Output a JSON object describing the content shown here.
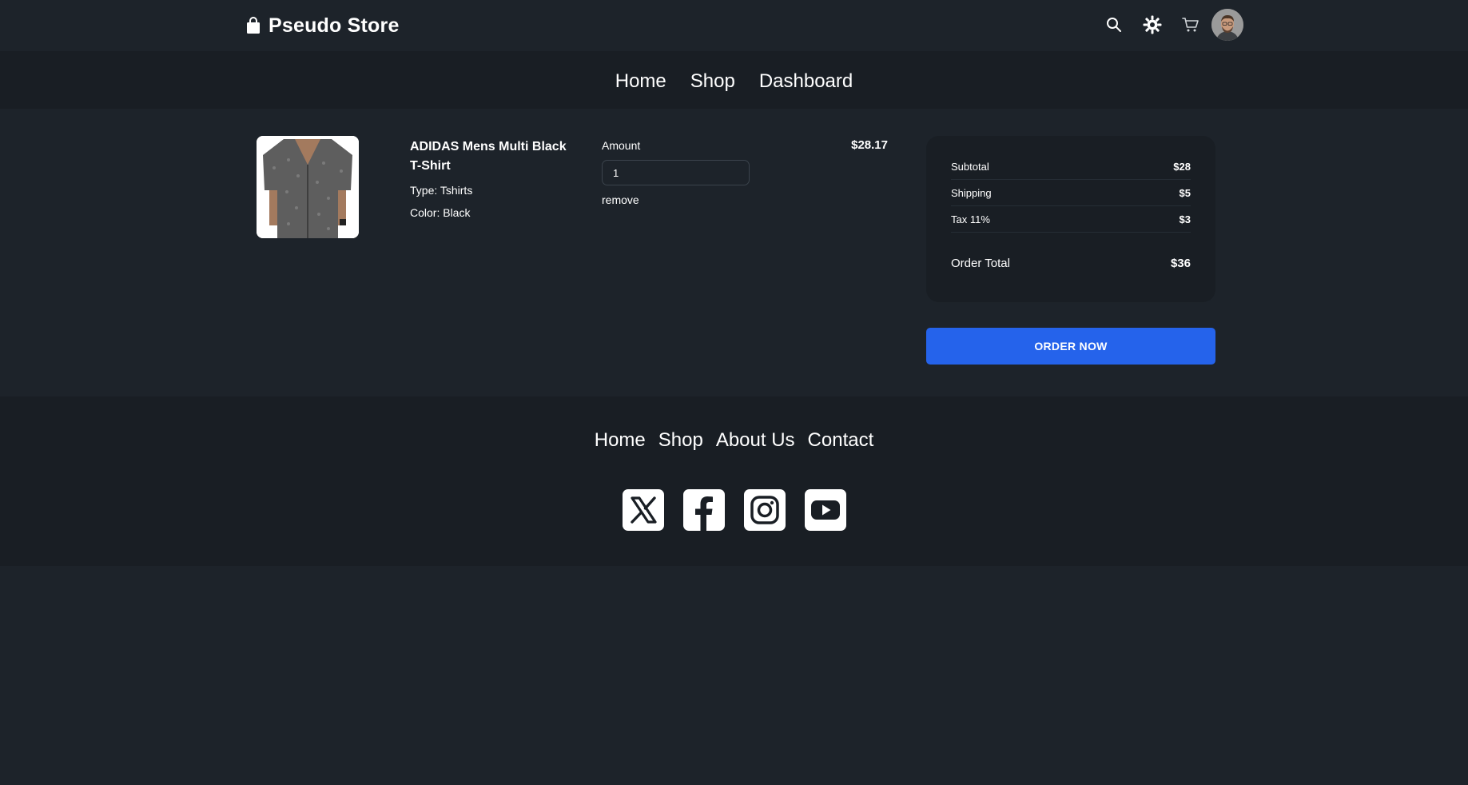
{
  "header": {
    "brand": "Pseudo Store",
    "icons": [
      "search-icon",
      "theme-toggle-icon",
      "cart-icon",
      "avatar"
    ]
  },
  "nav": {
    "items": [
      "Home",
      "Shop",
      "Dashboard"
    ]
  },
  "cart": {
    "item": {
      "name": "ADIDAS Mens Multi Black T-Shirt",
      "type": "Type: Tshirts",
      "color": "Color: Black",
      "amount_label": "Amount",
      "amount_value": "1",
      "remove_label": "remove",
      "price": "$28.17"
    },
    "summary": {
      "subtotal_label": "Subtotal",
      "subtotal_value": "$28",
      "shipping_label": "Shipping",
      "shipping_value": "$5",
      "tax_label": "Tax 11%",
      "tax_value": "$3",
      "total_label": "Order Total",
      "total_value": "$36"
    },
    "order_button": "ORDER NOW"
  },
  "footer": {
    "links": [
      "Home",
      "Shop",
      "About Us",
      "Contact"
    ],
    "socials": [
      "x-icon",
      "facebook-icon",
      "instagram-icon",
      "youtube-icon"
    ]
  },
  "colors": {
    "page_background": "#1d232a",
    "bar_background": "#191e24",
    "accent": "#2563eb",
    "text": "#ffffff"
  }
}
